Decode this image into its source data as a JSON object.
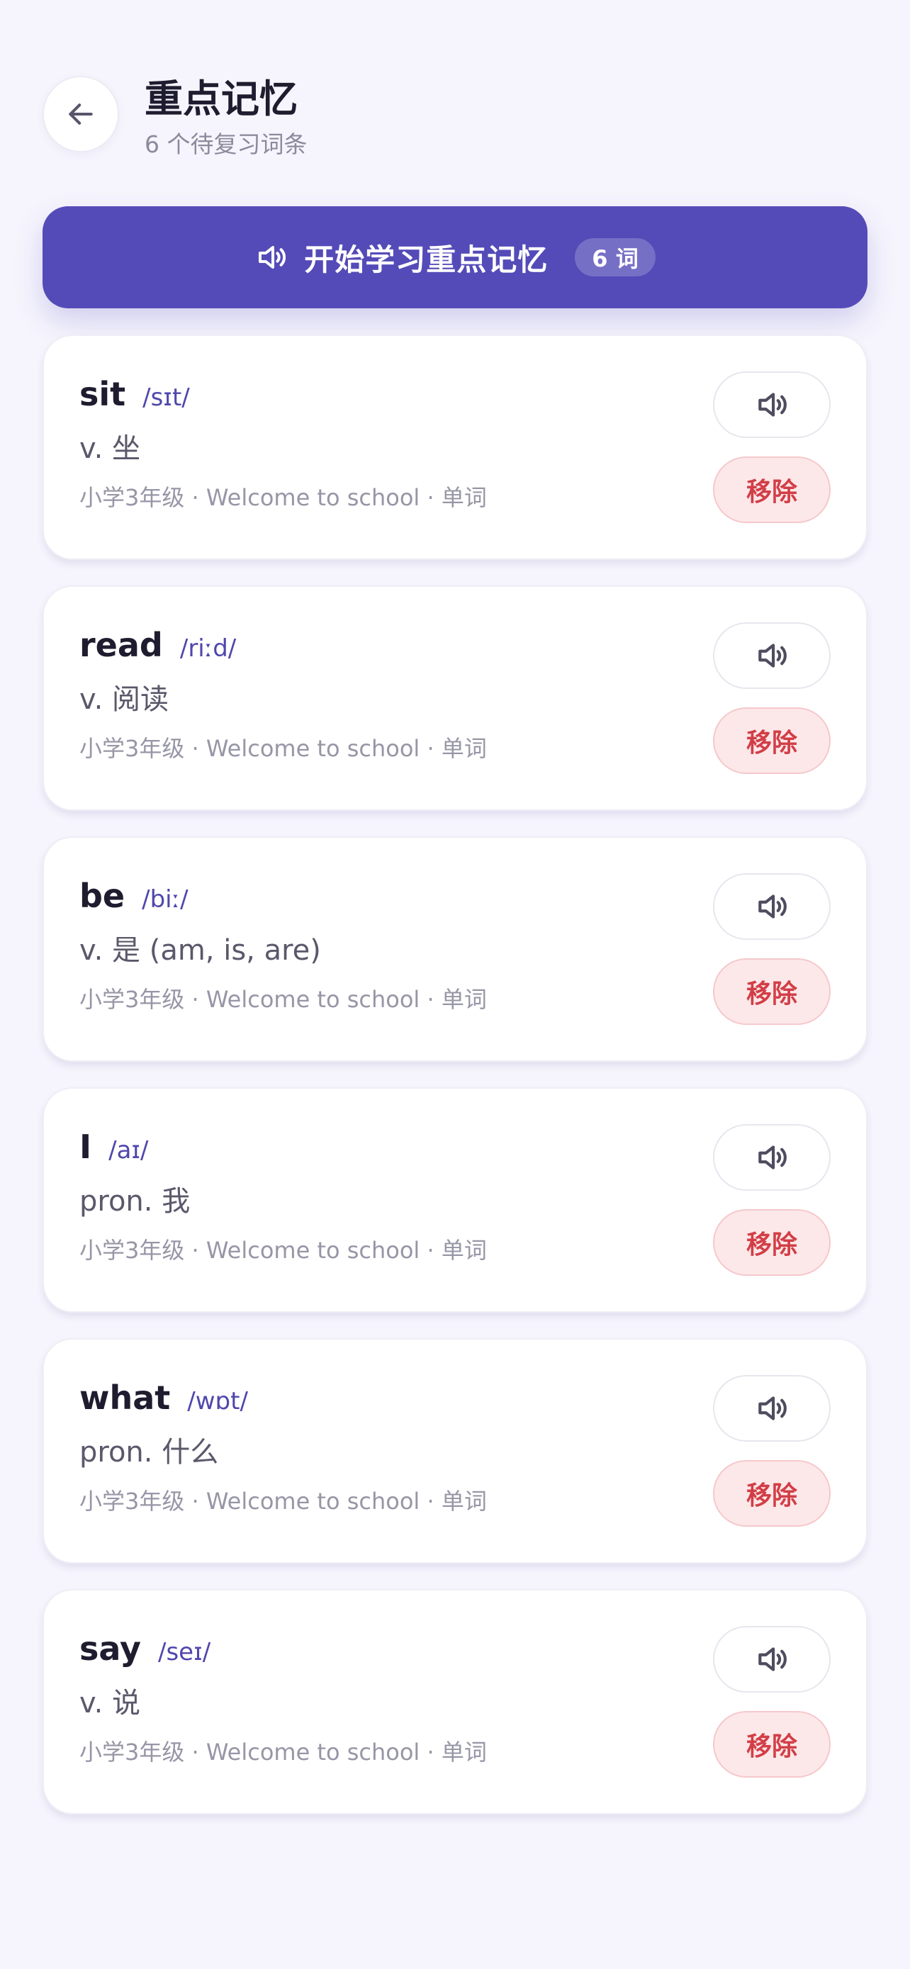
{
  "header": {
    "title": "重点记忆",
    "subtitle": "6 个待复习词条",
    "back_icon": "arrow-left-icon"
  },
  "start_button": {
    "label": "开始学习重点记忆",
    "count": "6 词",
    "icon": "speaker-icon"
  },
  "colors": {
    "accent": "#544bb8",
    "phonetic": "#4f47ad",
    "remove_text": "#d23e47",
    "remove_bg": "#fde8e9",
    "background": "#f6f5fd"
  },
  "cards": [
    {
      "word": "sit",
      "phonetic": "/sɪt/",
      "meaning": "v. 坐",
      "meta": "小学3年级 · Welcome to school · 单词",
      "remove_label": "移除"
    },
    {
      "word": "read",
      "phonetic": "/riːd/",
      "meaning": "v. 阅读",
      "meta": "小学3年级 · Welcome to school · 单词",
      "remove_label": "移除"
    },
    {
      "word": "be",
      "phonetic": "/biː/",
      "meaning": "v. 是 (am, is, are)",
      "meta": "小学3年级 · Welcome to school · 单词",
      "remove_label": "移除"
    },
    {
      "word": "I",
      "phonetic": "/aɪ/",
      "meaning": "pron. 我",
      "meta": "小学3年级 · Welcome to school · 单词",
      "remove_label": "移除"
    },
    {
      "word": "what",
      "phonetic": "/wɒt/",
      "meaning": "pron. 什么",
      "meta": "小学3年级 · Welcome to school · 单词",
      "remove_label": "移除"
    },
    {
      "word": "say",
      "phonetic": "/seɪ/",
      "meaning": "v. 说",
      "meta": "小学3年级 · Welcome to school · 单词",
      "remove_label": "移除"
    }
  ]
}
